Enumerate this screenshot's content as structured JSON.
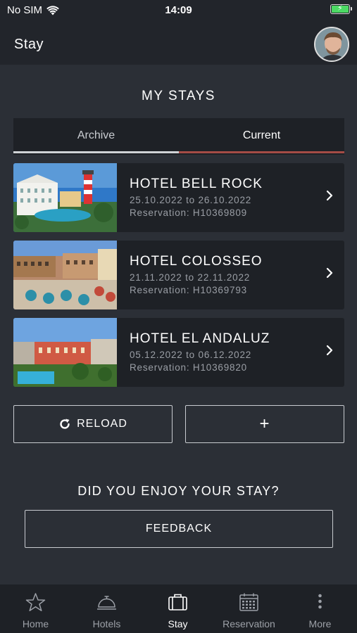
{
  "status_bar": {
    "carrier": "No SIM",
    "time": "14:09",
    "icons": [
      "wifi-icon",
      "battery-charging-icon"
    ]
  },
  "header": {
    "title": "Stay",
    "avatar": "user-avatar"
  },
  "page": {
    "section_title": "MY STAYS"
  },
  "tabs": [
    {
      "label": "Archive"
    },
    {
      "label": "Current"
    }
  ],
  "hotels": [
    {
      "name": "HOTEL BELL ROCK",
      "dates": "25.10.2022 to 26.10.2022",
      "reservation": "Reservation: H10369809"
    },
    {
      "name": "HOTEL COLOSSEO",
      "dates": "21.11.2022 to 22.11.2022",
      "reservation": "Reservation: H10369793"
    },
    {
      "name": "HOTEL EL ANDALUZ",
      "dates": "05.12.2022 to 06.12.2022",
      "reservation": "Reservation: H10369820"
    }
  ],
  "actions": {
    "reload_label": "RELOAD",
    "add_label": "+"
  },
  "feedback": {
    "question": "DID YOU ENJOY YOUR STAY?",
    "button_label": "FEEDBACK"
  },
  "tabbar": [
    {
      "label": "Home",
      "icon": "star-icon"
    },
    {
      "label": "Hotels",
      "icon": "bell-icon"
    },
    {
      "label": "Stay",
      "icon": "suitcase-icon"
    },
    {
      "label": "Reservation",
      "icon": "calendar-icon"
    },
    {
      "label": "More",
      "icon": "more-icon"
    }
  ],
  "colors": {
    "background": "#2b2f36",
    "card": "#1e2126",
    "accent": "#a54c46"
  }
}
